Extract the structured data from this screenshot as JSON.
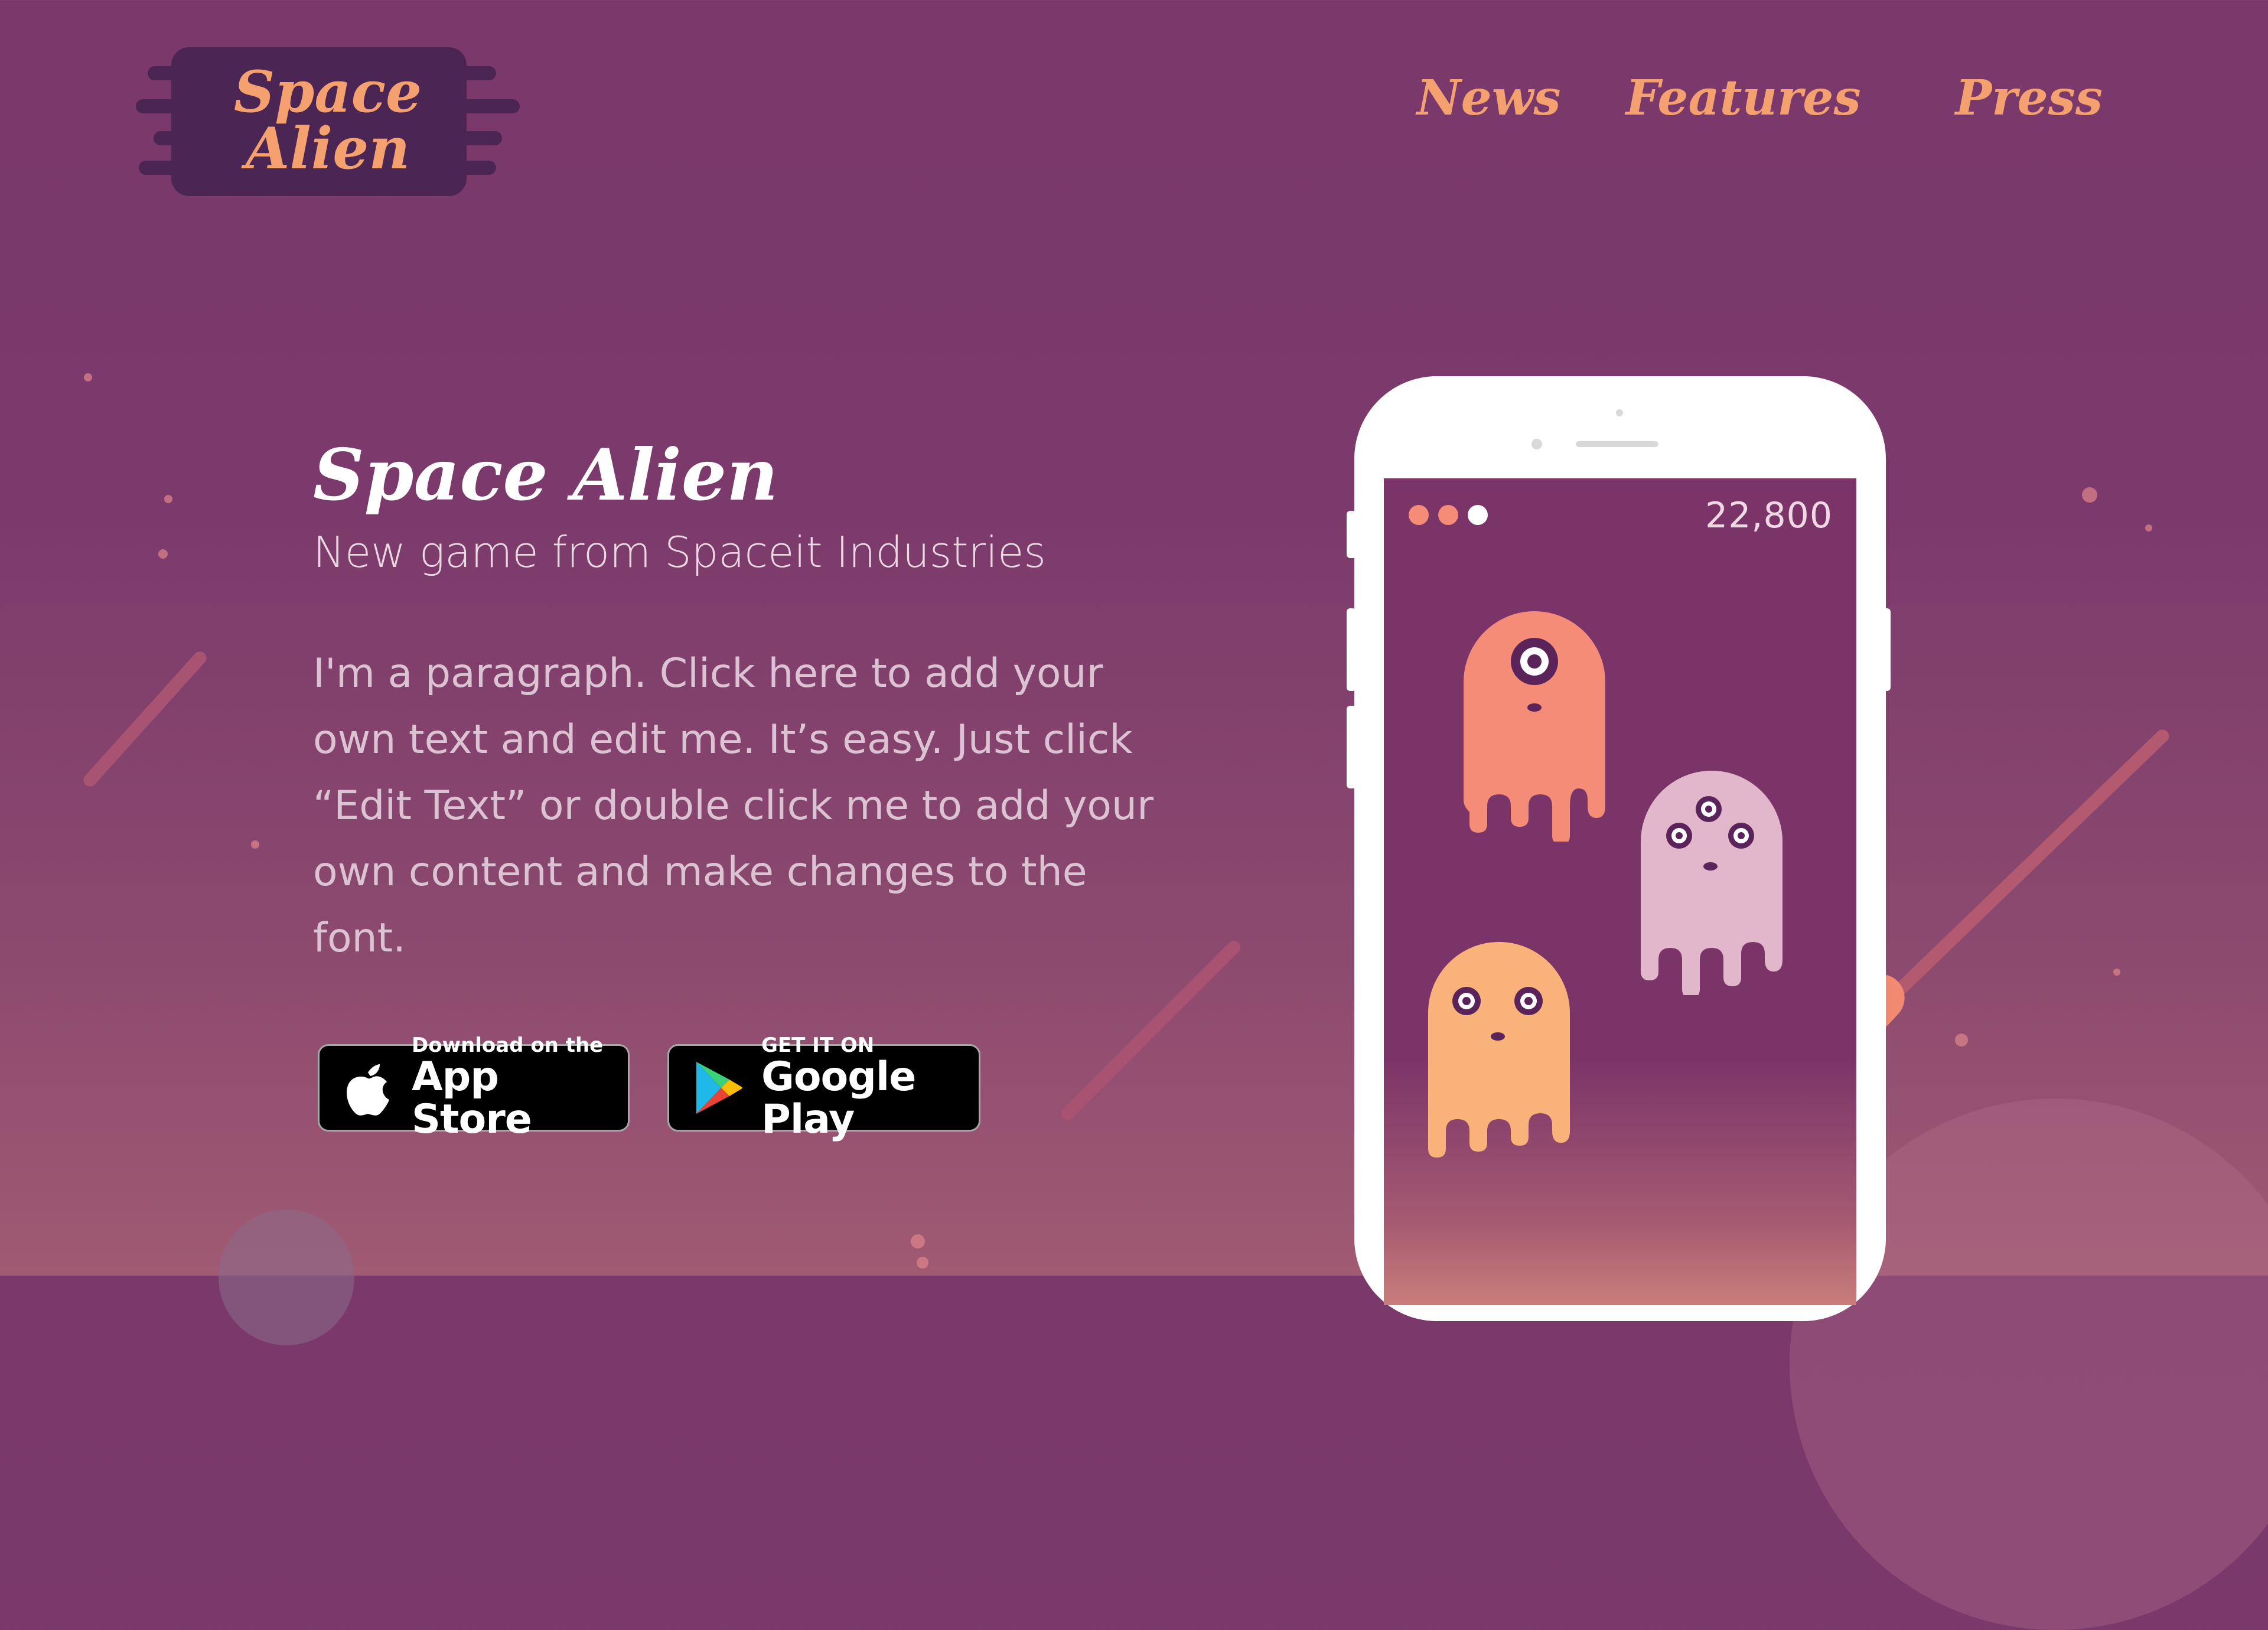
{
  "logo": {
    "text_line1": "Space",
    "text_line2": "Alien",
    "text_color": "#f4a16f",
    "bg_color": "#4b2553"
  },
  "nav": {
    "items": [
      {
        "label": "News"
      },
      {
        "label": "Features"
      },
      {
        "label": "Press"
      }
    ]
  },
  "hero": {
    "title": "Space Alien",
    "subtitle": "New game from Spaceit Industries",
    "paragraph": "I'm a paragraph. Click here to add your own text and edit me. It’s easy. Just click “Edit Text” or double click me to add your own content and make changes to the font."
  },
  "badges": {
    "app_store": {
      "small": "Download on the",
      "large": "App Store",
      "icon": "apple-icon"
    },
    "google_play": {
      "small": "GET IT ON",
      "large": "Google Play",
      "icon": "google-play-icon"
    }
  },
  "phone_game": {
    "score": "22,800",
    "lives": [
      {
        "color": "#f48c78"
      },
      {
        "color": "#f48c78"
      },
      {
        "color": "#ffffff"
      }
    ],
    "aliens": [
      "one-eyed-orange-alien",
      "three-eyed-pink-alien",
      "two-eyed-yellow-alien"
    ]
  },
  "colors": {
    "accent": "#f4a16f",
    "background": "#7a386b",
    "alien_orange": "#f48c78",
    "alien_pink": "#e2b7cb",
    "alien_yellow": "#f8b27a"
  }
}
